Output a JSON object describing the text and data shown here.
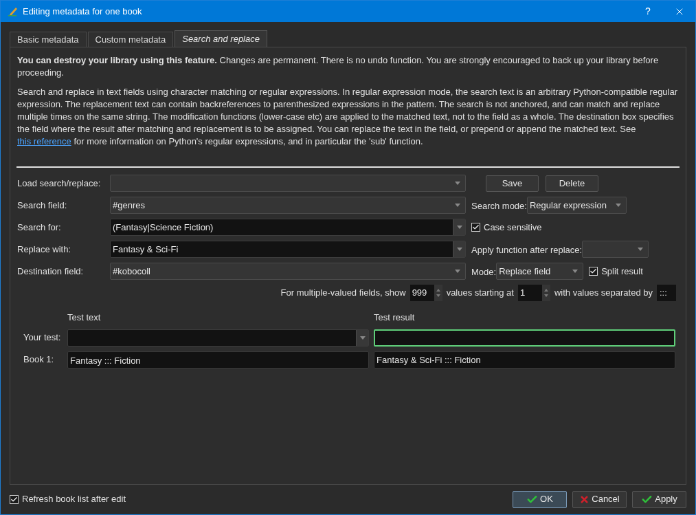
{
  "window": {
    "title": "Editing metadata for one book",
    "help": "?"
  },
  "tabs": [
    {
      "label": "Basic metadata",
      "selected": false
    },
    {
      "label": "Custom metadata",
      "selected": false
    },
    {
      "label": "Search and replace",
      "selected": true
    }
  ],
  "warning": "**You can destroy your library using this feature.** Changes are permanent. There is no undo function. You are strongly encouraged to back up your library before proceeding.",
  "description": {
    "before": "Search and replace in text fields using character matching or regular expressions. In regular expression mode, the search text is an arbitrary Python-compatible regular expression. The replacement text can contain backreferences to parenthesized expressions in the pattern. The search is not anchored, and can match and replace multiple times on the same string. The modification functions (lower-case etc) are applied to the matched text, not to the field as a whole. The destination box specifies the field where the result after matching and replacement is to be assigned. You can replace the text in the field, or prepend or append the matched text. See",
    "link": "this reference",
    "after": "for more information on Python's regular expressions, and in particular the 'sub' function."
  },
  "load": {
    "label": "Load search/replace:",
    "buttons": [
      "Save",
      "Delete"
    ]
  },
  "search_field": {
    "label": "Search field:",
    "value": "#genres",
    "mode_label": "Search mode:",
    "mode": "Regular expression"
  },
  "search_for": {
    "label": "Search for:",
    "value": "(Fantasy|Science Fiction)",
    "checkbox": {
      "label": "Case sensitive",
      "checked": true
    }
  },
  "replace_with": {
    "label": "Replace with:",
    "value": "Fantasy & Sci-Fi",
    "function_label": "Apply function after replace:"
  },
  "destination": {
    "label": "Destination field:",
    "value": "#kobocoll",
    "mode_label": "Mode:",
    "mode": "Replace field",
    "checkbox": {
      "label": "Split result",
      "checked": true
    }
  },
  "multi": {
    "show_label": "For multiple-valued fields, show",
    "show": "999",
    "start_label": "values starting at",
    "start": "1",
    "sep_label": "with values separated by",
    "sep": ":::"
  },
  "test": {
    "text_header": "Test text",
    "result_header": "Test result",
    "rows": [
      {
        "label": "Your test:",
        "text": "",
        "result": "",
        "focused": true
      },
      {
        "label": "Book 1:",
        "text": "Fantasy ::: Fiction",
        "result": "Fantasy & Sci-Fi ::: Fiction",
        "focused": false
      }
    ]
  },
  "refresh": {
    "label": "Refresh book list after edit",
    "checked": true
  },
  "buttons": [
    {
      "label": "OK",
      "kind": "ok"
    },
    {
      "label": "Cancel",
      "kind": "cancel"
    },
    {
      "label": "Apply",
      "kind": "apply"
    }
  ]
}
